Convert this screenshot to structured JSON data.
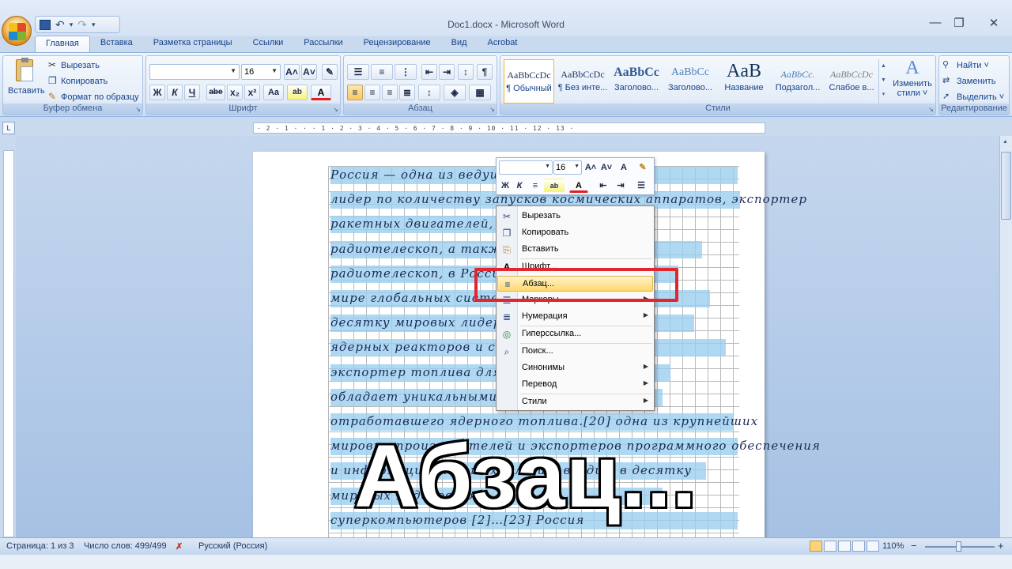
{
  "window": {
    "title": "Doc1.docx - Microsoft Word",
    "minimize": "—",
    "restore": "❐",
    "close": "✕"
  },
  "qat": {
    "save_icon": "save-icon",
    "undo_glyph": "↶",
    "redo_glyph": "↷",
    "dropdown_glyph": "▾",
    "customize_glyph": "₹"
  },
  "tabs": [
    "Главная",
    "Вставка",
    "Разметка страницы",
    "Ссылки",
    "Рассылки",
    "Рецензирование",
    "Вид",
    "Acrobat"
  ],
  "ribbon": {
    "clipboard": {
      "label": "Буфер обмена",
      "paste": "Вставить",
      "cut": "Вырезать",
      "copy": "Копировать",
      "format_painter": "Формат по образцу"
    },
    "font": {
      "label": "Шрифт",
      "font_name": "",
      "font_size": "16",
      "grow": "A˄",
      "shrink": "A˅",
      "bold": "Ж",
      "italic": "К",
      "underline": "Ч",
      "strike": "abe",
      "subscript": "x₂",
      "superscript": "x²",
      "change_case": "Aa",
      "highlight": "ab",
      "font_color": "A"
    },
    "paragraph": {
      "label": "Абзац"
    },
    "styles": {
      "label": "Стили",
      "items": [
        {
          "sample": "AaBbCcDc",
          "name": "¶ Обычный"
        },
        {
          "sample": "AaBbCcDc",
          "name": "¶ Без инте..."
        },
        {
          "sample": "AaBbCc",
          "name": "Заголово..."
        },
        {
          "sample": "AaBbCc",
          "name": "Заголово..."
        },
        {
          "sample": "AaB",
          "name": "Название"
        },
        {
          "sample": "AaBbCc.",
          "name": "Подзагол..."
        },
        {
          "sample": "AaBbCcDc",
          "name": "Слабое в..."
        }
      ],
      "change_styles_1": "Изменить",
      "change_styles_2": "стили ˅"
    },
    "editing": {
      "label": "Редактирование",
      "find": "Найти ˅",
      "replace": "Заменить",
      "select": "Выделить ˅"
    }
  },
  "ruler": {
    "marks": "· 2 · 1 · · · 1 · 2 · 3 · 4 · 5 · 6 · 7 · 8 · 9 · 10 · 11 · 12 · 13 ·"
  },
  "document": {
    "lines": [
      "Россия — одна из ведущих",
      "лидер по количеству запусков космических аппаратов, экспортер",
      "ракетных двигателей, мно",
      "радиотелескоп, а также к",
      "радиотелескоп, в Россиис",
      "мире глобальных систем",
      "десятку мировых лидеров п",
      "ядерных реакторов и сопут",
      "экспортер топлива для ат",
      "обладает уникальными по",
      "отработавшего ядерного топлива.[20] одна из крупнейших",
      "мировых производителей и экспортеров программного обеспечения",
      "и информационных технологий, входит в десятку",
      "мировых лидеров по",
      "суперкомпьютеров [2]…[23] Россия"
    ]
  },
  "mini_toolbar": {
    "font_name": "",
    "font_size": "16",
    "grow": "A˄",
    "shrink": "A˅",
    "bold": "Ж",
    "italic": "К",
    "align": "≡",
    "highlight": "ab",
    "font_color": "A"
  },
  "context_menu": {
    "items": [
      {
        "label": "Вырезать",
        "icon": "✂",
        "submenu": false
      },
      {
        "label": "Копировать",
        "icon": "❐",
        "submenu": false
      },
      {
        "label": "Вставить",
        "icon": "⎘",
        "submenu": false
      },
      {
        "label": "Шрифт...",
        "icon": "A",
        "submenu": false
      },
      {
        "label": "Абзац...",
        "icon": "≡",
        "submenu": false
      },
      {
        "label": "Маркеры",
        "icon": "☰",
        "submenu": true
      },
      {
        "label": "Нумерация",
        "icon": "≣",
        "submenu": true
      },
      {
        "label": "Гиперссылка...",
        "icon": "◎",
        "submenu": false
      },
      {
        "label": "Поиск...",
        "icon": "⌕",
        "submenu": false
      },
      {
        "label": "Синонимы",
        "icon": "",
        "submenu": true
      },
      {
        "label": "Перевод",
        "icon": "",
        "submenu": true
      },
      {
        "label": "Стили",
        "icon": "",
        "submenu": true
      }
    ],
    "submenu_arrow": "▶"
  },
  "overlay": {
    "caption": "Абзац..."
  },
  "status": {
    "page": "Страница: 1 из 3",
    "words": "Число слов: 499/499",
    "language": "Русский (Россия)",
    "zoom": "110%",
    "zoom_minus": "−",
    "zoom_plus": "+"
  },
  "colors": {
    "accent": "#15428b",
    "highlight": "#98cdf0",
    "callout": "#e3262d",
    "menu_hover": "#ffd86e"
  }
}
